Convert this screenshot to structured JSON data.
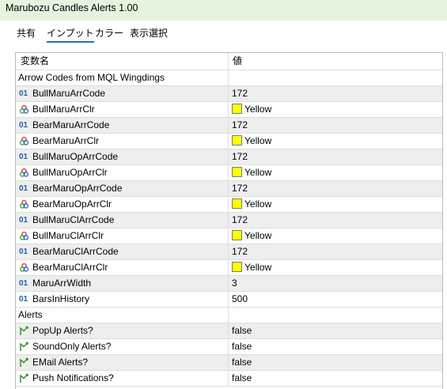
{
  "window": {
    "title": "Marubozu Candles Alerts 1.00"
  },
  "tabs": [
    {
      "label": "共有"
    },
    {
      "label": "インプット"
    },
    {
      "label": "カラー"
    },
    {
      "label": "表示選択"
    }
  ],
  "table": {
    "col_name": "変数名",
    "col_value": "値",
    "groups": [
      "Arrow Codes from MQL Wingdings",
      "Alerts"
    ],
    "rows": [
      {
        "type": "int",
        "name": "BullMaruArrCode",
        "value": "172"
      },
      {
        "type": "color",
        "name": "BullMaruArrClr",
        "value": "Yellow"
      },
      {
        "type": "int",
        "name": "BearMaruArrCode",
        "value": "172"
      },
      {
        "type": "color",
        "name": "BearMaruArrClr",
        "value": "Yellow"
      },
      {
        "type": "int",
        "name": "BullMaruOpArrCode",
        "value": "172"
      },
      {
        "type": "color",
        "name": "BullMaruOpArrClr",
        "value": "Yellow"
      },
      {
        "type": "int",
        "name": "BearMaruOpArrCode",
        "value": "172"
      },
      {
        "type": "color",
        "name": "BearMaruOpArrClr",
        "value": "Yellow"
      },
      {
        "type": "int",
        "name": "BullMaruClArrCode",
        "value": "172"
      },
      {
        "type": "color",
        "name": "BullMaruClArrClr",
        "value": "Yellow"
      },
      {
        "type": "int",
        "name": "BearMaruClArrCode",
        "value": "172"
      },
      {
        "type": "color",
        "name": "BearMaruClArrClr",
        "value": "Yellow"
      },
      {
        "type": "int",
        "name": "MaruArrWidth",
        "value": "3"
      },
      {
        "type": "int",
        "name": "BarsInHistory",
        "value": "500"
      },
      {
        "type": "bool",
        "name": "PopUp Alerts?",
        "value": "false"
      },
      {
        "type": "bool",
        "name": "SoundOnly Alerts?",
        "value": "false"
      },
      {
        "type": "bool",
        "name": "EMail Alerts?",
        "value": "false"
      },
      {
        "type": "bool",
        "name": "Push Notifications?",
        "value": "false"
      }
    ],
    "int_icon_text": "01",
    "color_swatch": "#ffff00"
  },
  "colors": {
    "titlebar_bg": "#e6f3df",
    "tab_underline": "#1f6fbf",
    "int_icon": "#1f5fae",
    "bool_icon": "#2e9a2e"
  },
  "icons": {
    "int": "integer-type-icon",
    "color": "color-type-icon",
    "bool": "boolean-type-icon"
  }
}
